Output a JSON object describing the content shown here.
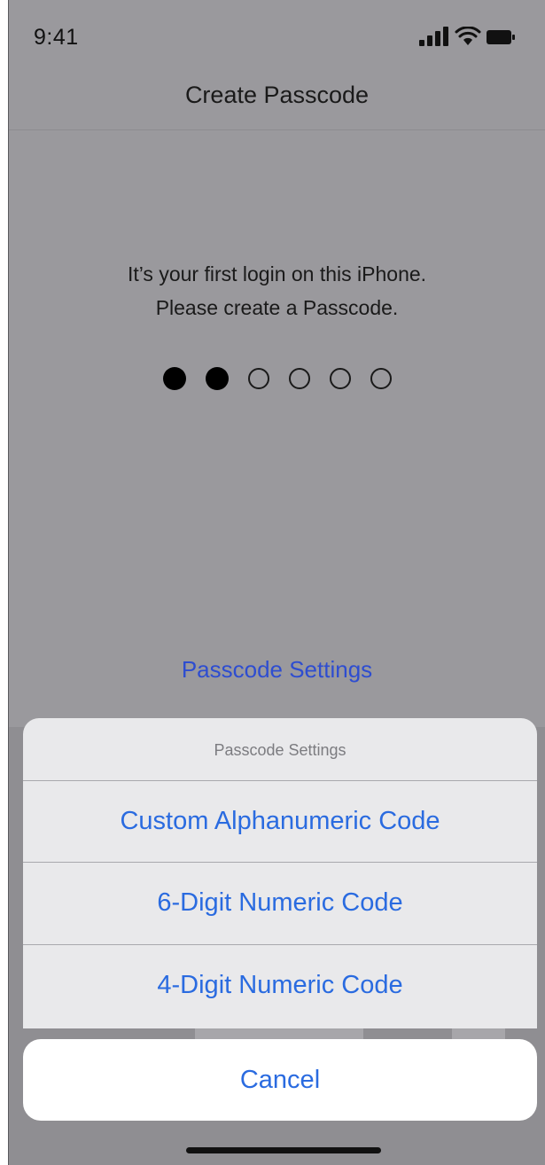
{
  "status_bar": {
    "time": "9:41",
    "icons": [
      "signal-icon",
      "wifi-icon",
      "battery-icon"
    ]
  },
  "nav": {
    "title": "Create Passcode"
  },
  "prompt": {
    "line1": "It’s your first login on this iPhone.",
    "line2": "Please create a Passcode."
  },
  "passcode": {
    "length": 6,
    "entered": 2
  },
  "settings_link": "Passcode Settings",
  "action_sheet": {
    "title": "Passcode Settings",
    "options": [
      "Custom Alphanumeric Code",
      "6-Digit Numeric Code",
      "4-Digit Numeric Code"
    ],
    "cancel": "Cancel"
  },
  "colors": {
    "accent": "#2a6be0",
    "link": "#2e4dd0",
    "dim_background": "#9a999d"
  }
}
